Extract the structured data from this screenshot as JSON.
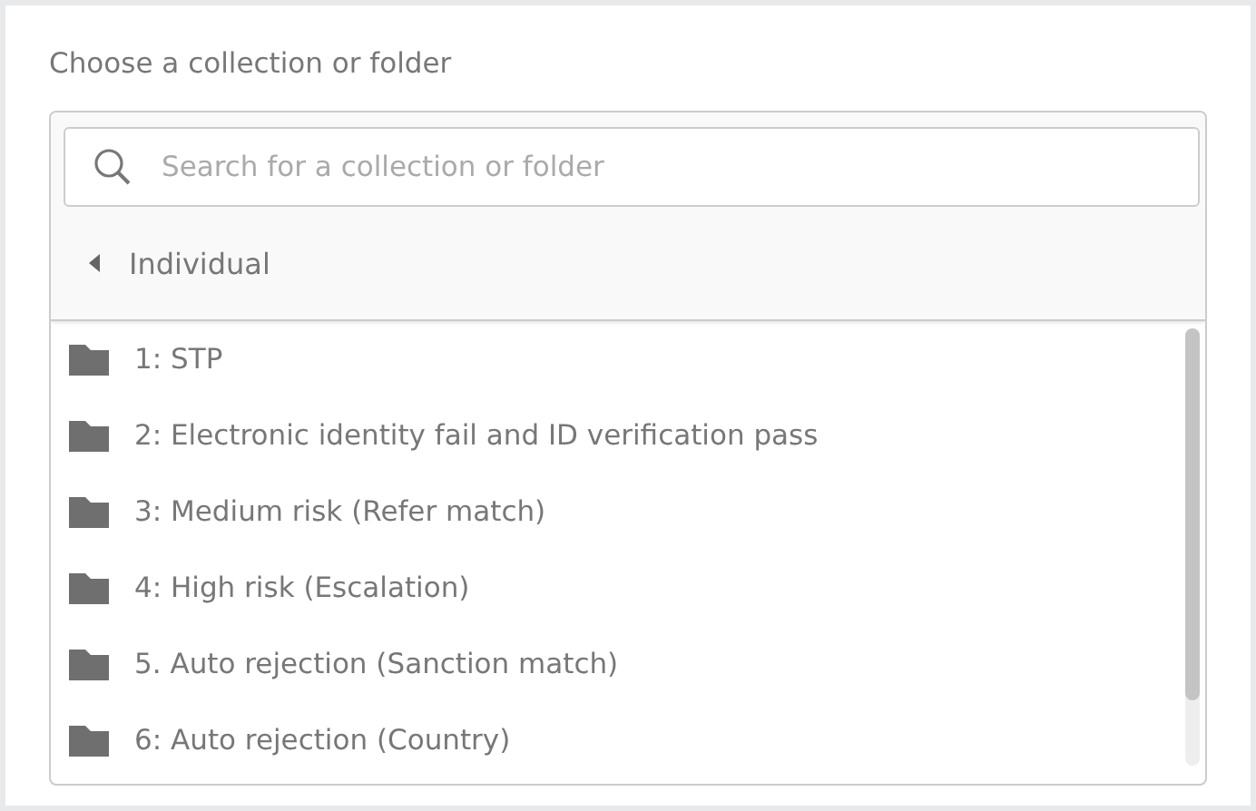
{
  "label": "Choose a collection or folder",
  "search": {
    "placeholder": "Search for a collection or folder"
  },
  "breadcrumb": {
    "label": "Individual"
  },
  "items": [
    {
      "label": "1: STP"
    },
    {
      "label": "2: Electronic identity fail and ID verification pass"
    },
    {
      "label": "3: Medium risk (Refer match)"
    },
    {
      "label": "4: High risk (Escalation)"
    },
    {
      "label": "5. Auto rejection (Sanction match)"
    },
    {
      "label": "6: Auto rejection (Country)"
    }
  ]
}
